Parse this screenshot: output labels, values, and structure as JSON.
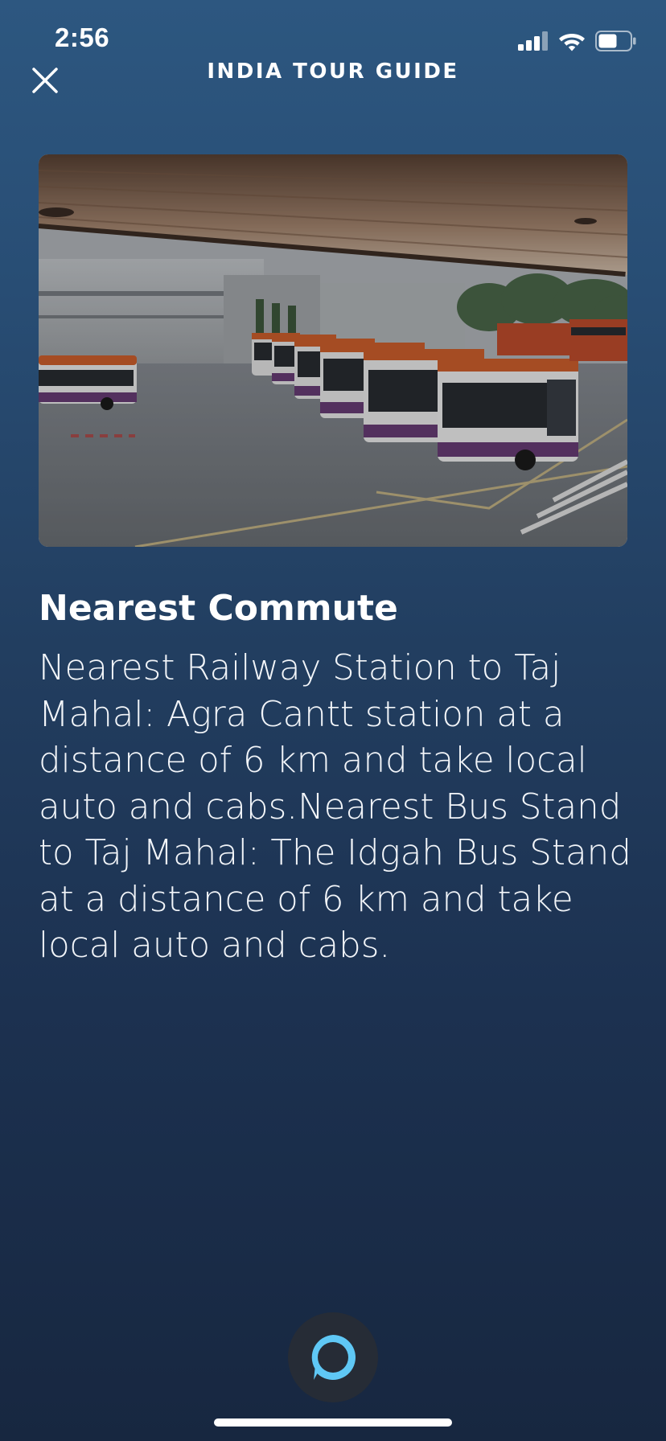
{
  "status_bar": {
    "time": "2:56",
    "icons": [
      "cellular-signal-icon",
      "wifi-icon",
      "battery-icon"
    ]
  },
  "header": {
    "title": "INDIA TOUR GUIDE",
    "close_icon": "close-icon"
  },
  "hero_image": {
    "description_icon": "bus-terminal-photo"
  },
  "content": {
    "title": "Nearest Commute",
    "body": "Nearest Railway Station to Taj Mahal: Agra Cantt station at a distance of 6 km and take local auto and cabs.Nearest Bus Stand to Taj Mahal: The Idgah Bus Stand at a distance of 6 km and take local auto and cabs."
  },
  "alexa": {
    "icon": "alexa-ring-icon",
    "accent_color": "#5fc8f5"
  },
  "colors": {
    "background_top": "#2d5780",
    "background_bottom": "#172740",
    "text": "#ffffff"
  }
}
